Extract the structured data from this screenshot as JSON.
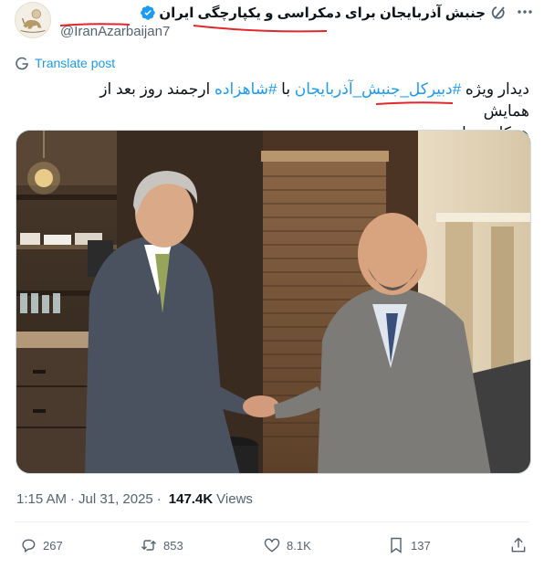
{
  "author": {
    "display_name": "جنبش آذربایجان برای دمکراسی و یکپارچگی ایران",
    "handle": "@IranAzarbaijan7",
    "verified": true
  },
  "translate_label": "Translate post",
  "tweet": {
    "line1_prefix": "دیدار ویژه ",
    "hashtag1": "#دبیرکل_جنبش_آذربایجان",
    "line1_mid": " با ",
    "hashtag2": "#شاهزاده",
    "line1_suffix": " ارجمند روز بعد از همایش",
    "line2": "همکاری ملی"
  },
  "meta": {
    "time": "1:15 AM",
    "separator": "·",
    "date": "Jul 31, 2025",
    "views_count": "147.4K",
    "views_label": "Views"
  },
  "actions": {
    "replies": "267",
    "reposts": "853",
    "likes": "8.1K",
    "bookmarks": "137"
  },
  "colors": {
    "accent": "#1d9bf0",
    "text": "#0f1419",
    "muted": "#536471",
    "annotation_red": "#e0282c"
  },
  "icons": [
    "grok-icon",
    "more-icon",
    "verified-icon",
    "translate-icon",
    "reply-icon",
    "repost-icon",
    "like-icon",
    "bookmark-icon",
    "share-icon"
  ]
}
